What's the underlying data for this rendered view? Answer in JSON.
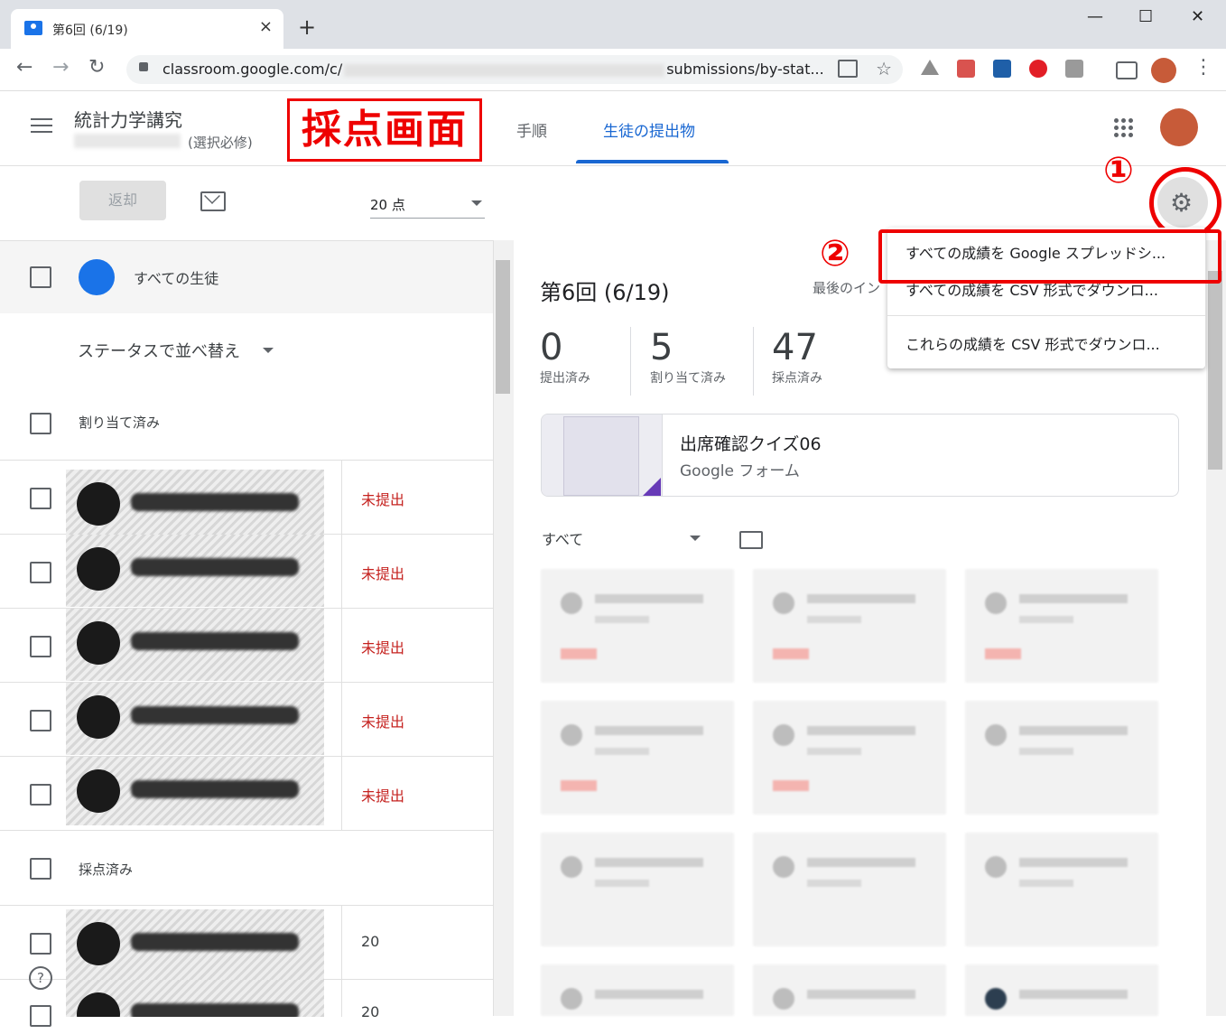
{
  "browser": {
    "tab_title": "第6回 (6/19)",
    "tab_close": "×",
    "new_tab": "+",
    "win_min": "—",
    "win_max": "☐",
    "win_close": "✕",
    "url_prefix": "classroom.google.com/c/",
    "url_suffix": "submissions/by-stat...",
    "back": "←",
    "forward": "→",
    "reload": "↻",
    "star": "☆",
    "menu_dots": "⋮"
  },
  "header": {
    "class_title": "統計力学講究",
    "class_subtitle": "(選択必修)",
    "annotation_label": "採点画面",
    "tabs": [
      {
        "label": "手順"
      },
      {
        "label": "生徒の提出物"
      }
    ]
  },
  "toolbar": {
    "return_label": "返却",
    "points": "20 点",
    "gear": "⚙"
  },
  "annotations": {
    "step1": "①",
    "step2": "②"
  },
  "left": {
    "all_students": "すべての生徒",
    "sort_label": "ステータスで並べ替え",
    "group_assigned": "割り当て済み",
    "group_graded": "採点済み",
    "students": [
      {
        "status": "未提出"
      },
      {
        "status": "未提出"
      },
      {
        "status": "未提出"
      },
      {
        "status": "未提出"
      },
      {
        "status": "未提出"
      },
      {
        "status": "20"
      },
      {
        "status": "20"
      }
    ],
    "help": "?"
  },
  "right": {
    "title": "第6回 (6/19)",
    "last_label": "最後のイン",
    "stats": [
      {
        "num": "0",
        "label": "提出済み"
      },
      {
        "num": "5",
        "label": "割り当て済み"
      },
      {
        "num": "47",
        "label": "採点済み"
      }
    ],
    "attachment_title": "出席確認クイズ06",
    "attachment_type": "Google フォーム",
    "filter_label": "すべて"
  },
  "menu": {
    "items": [
      {
        "label": "すべての成績を Google スプレッドシ..."
      },
      {
        "label": "すべての成績を CSV 形式でダウンロ..."
      },
      {
        "label": "これらの成績を CSV 形式でダウンロ..."
      }
    ]
  },
  "colors": {
    "accent": "#1967d2",
    "annotation_red": "#e00000",
    "status_red": "#c5221f"
  }
}
